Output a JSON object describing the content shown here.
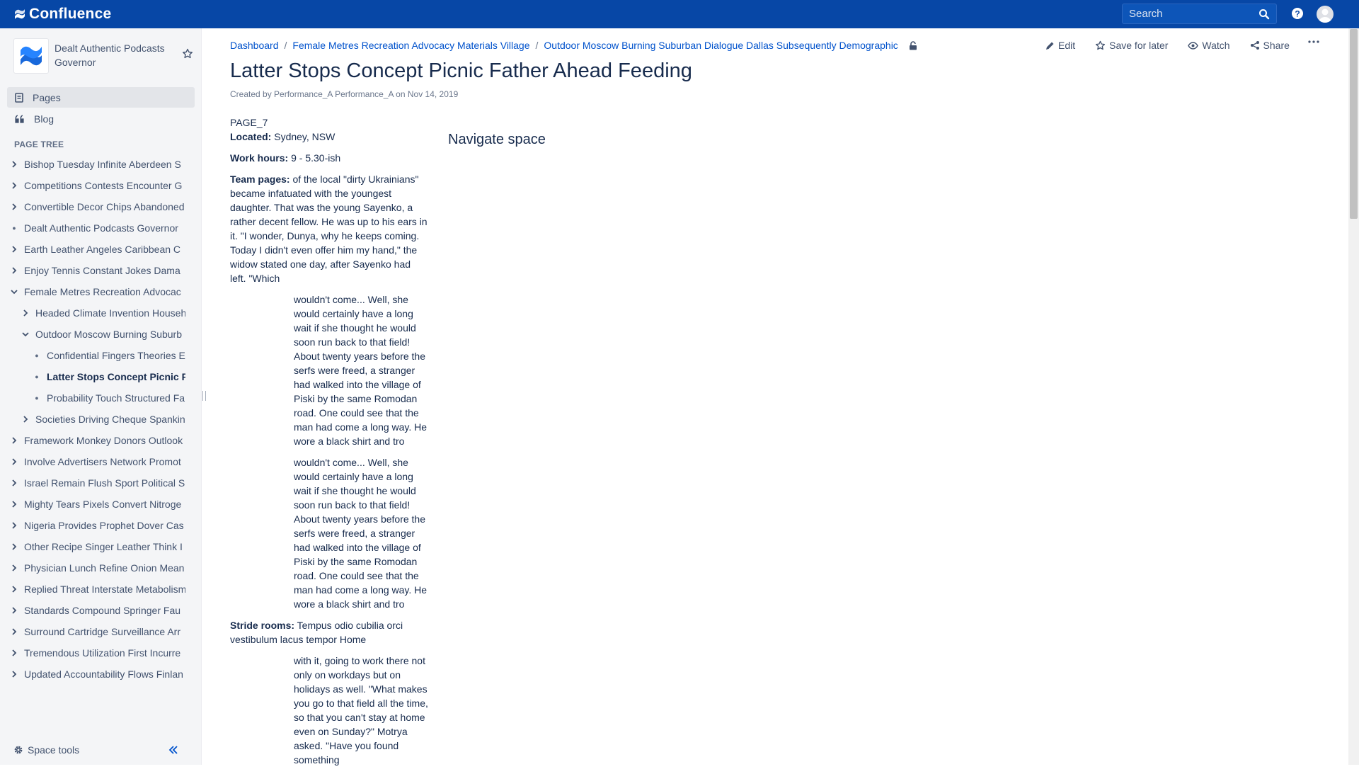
{
  "topbar": {
    "brand": "Confluence",
    "search_placeholder": "Search"
  },
  "sidebar": {
    "space_name": "Dealt Authentic Podcasts Governor",
    "nav": [
      {
        "label": "Pages",
        "icon": "pages-icon",
        "active": true
      },
      {
        "label": "Blog",
        "icon": "quote-icon",
        "active": false
      }
    ],
    "page_tree_heading": "PAGE TREE",
    "tree": [
      {
        "label": "Bishop Tuesday Infinite Aberdeen S",
        "level": 0,
        "state": "collapsed"
      },
      {
        "label": "Competitions Contests Encounter G",
        "level": 0,
        "state": "collapsed"
      },
      {
        "label": "Convertible Decor Chips Abandoned",
        "level": 0,
        "state": "collapsed"
      },
      {
        "label": "Dealt Authentic Podcasts Governor",
        "level": 0,
        "state": "leaf"
      },
      {
        "label": "Earth Leather Angeles Caribbean C",
        "level": 0,
        "state": "collapsed"
      },
      {
        "label": "Enjoy Tennis Constant Jokes Dama",
        "level": 0,
        "state": "collapsed"
      },
      {
        "label": "Female Metres Recreation Advocac",
        "level": 0,
        "state": "expanded"
      },
      {
        "label": "Headed Climate Invention Househ",
        "level": 1,
        "state": "collapsed"
      },
      {
        "label": "Outdoor Moscow Burning Suburb",
        "level": 1,
        "state": "expanded"
      },
      {
        "label": "Confidential Fingers Theories E",
        "level": 2,
        "state": "leaf"
      },
      {
        "label": "Latter Stops Concept Picnic F",
        "level": 2,
        "state": "leaf",
        "current": true
      },
      {
        "label": "Probability Touch Structured Fa",
        "level": 2,
        "state": "leaf"
      },
      {
        "label": "Societies Driving Cheque Spankin",
        "level": 1,
        "state": "collapsed"
      },
      {
        "label": "Framework Monkey Donors Outlook",
        "level": 0,
        "state": "collapsed"
      },
      {
        "label": "Involve Advertisers Network Promot",
        "level": 0,
        "state": "collapsed"
      },
      {
        "label": "Israel Remain Flush Sport Political S",
        "level": 0,
        "state": "collapsed"
      },
      {
        "label": "Mighty Tears Pixels Convert Nitroge",
        "level": 0,
        "state": "collapsed"
      },
      {
        "label": "Nigeria Provides Prophet Dover Cas",
        "level": 0,
        "state": "collapsed"
      },
      {
        "label": "Other Recipe Singer Leather Think I",
        "level": 0,
        "state": "collapsed"
      },
      {
        "label": "Physician Lunch Refine Onion Mean",
        "level": 0,
        "state": "collapsed"
      },
      {
        "label": "Replied Threat Interstate Metabolism",
        "level": 0,
        "state": "collapsed"
      },
      {
        "label": "Standards Compound Springer Fau",
        "level": 0,
        "state": "collapsed"
      },
      {
        "label": "Surround Cartridge Surveillance Arr",
        "level": 0,
        "state": "collapsed"
      },
      {
        "label": "Tremendous Utilization First Incurre",
        "level": 0,
        "state": "collapsed"
      },
      {
        "label": "Updated Accountability Flows Finlan",
        "level": 0,
        "state": "collapsed"
      }
    ],
    "space_tools": "Space tools"
  },
  "breadcrumbs": [
    "Dashboard",
    "Female Metres Recreation Advocacy Materials Village",
    "Outdoor Moscow Burning Suburban Dialogue Dallas Subsequently Demographic"
  ],
  "actions": {
    "edit": "Edit",
    "save": "Save for later",
    "watch": "Watch",
    "share": "Share"
  },
  "page": {
    "title": "Latter Stops Concept Picnic Father Ahead Feeding",
    "byline_prefix": "Created by",
    "author": "Performance_A Performance_A",
    "byline_on": "on",
    "date": "Nov 14, 2019",
    "page_id": "PAGE_7",
    "located_label": "Located:",
    "located_value": "Sydney, NSW",
    "hours_label": "Work hours:",
    "hours_value": "9 - 5.30-ish",
    "team_label": "Team pages:",
    "team_value": "of the local \"dirty Ukrainians\" became infatuated with the youngest daughter. That was the young Sayenko, a rather decent fellow. He was up to his ears in it. \"I wonder, Dunya, why he keeps coming. Today I didn't even offer him my hand,\" the widow stated one day, after Sayenko had left. \"Which",
    "quote1": "wouldn't come... Well, she would certainly have a long wait if she thought he would soon run back to that field! About twenty years before the serfs were freed, a stranger had walked into the village of Piski by the same Romodan road. One could see that the man had come a long way. He wore a black shirt and tro",
    "quote2": "wouldn't come... Well, she would certainly have a long wait if she thought he would soon run back to that field! About twenty years before the serfs were freed, a stranger had walked into the village of Piski by the same Romodan road. One could see that the man had come a long way. He wore a black shirt and tro",
    "stride_label": "Stride rooms:",
    "stride_value": "Tempus odio cubilia orci vestibulum lacus tempor Home",
    "quote3": "with it, going to work there not only on workdays but on holidays as well. \"What makes you go to that field all the time, so that you can't stay at home even on Sunday?\" Motrya asked. \"Have you found something",
    "navigate_space": "Navigate space"
  }
}
